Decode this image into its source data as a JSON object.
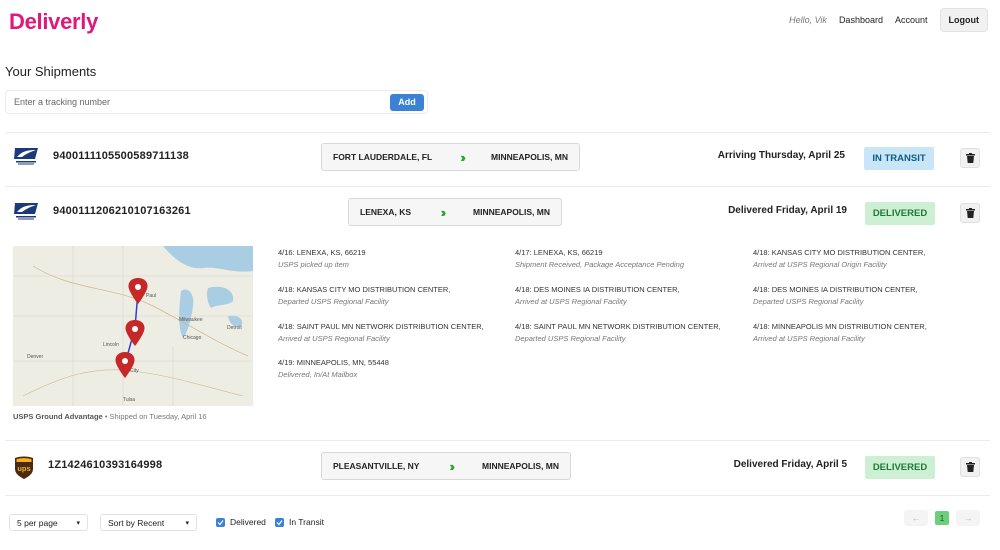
{
  "header": {
    "logo": "Deliverly",
    "greeting": "Hello, Vik",
    "nav_dashboard": "Dashboard",
    "nav_account": "Account",
    "logout": "Logout"
  },
  "page": {
    "title": "Your Shipments",
    "tracking_placeholder": "Enter a tracking number",
    "add_label": "Add"
  },
  "shipments": [
    {
      "carrier_icon": "usps-eagle-icon",
      "tracking": "9400111105500589711138",
      "origin": "FORT LAUDERDALE, FL",
      "destination": "MINNEAPOLIS, MN",
      "arrival": "Arriving Thursday, April 25",
      "status": "IN TRANSIT"
    },
    {
      "carrier_icon": "usps-eagle-icon",
      "tracking": "9400111206210107163261",
      "origin": "LENEXA, KS",
      "destination": "MINNEAPOLIS, MN",
      "arrival": "Delivered Friday, April 19",
      "status": "DELIVERED",
      "map_caption_service": "USPS Ground Advantage",
      "map_caption_rest": " • Shipped on Tuesday, April 16",
      "map_labels": [
        "Paul",
        "Milwaukee",
        "Detroit",
        "Chicago",
        "Lincoln",
        "Denver",
        "City",
        "Tulsa"
      ],
      "events": [
        {
          "loc": "4/16: LENEXA, KS, 66219",
          "desc": "USPS picked up item"
        },
        {
          "loc": "4/17: LENEXA, KS, 66219",
          "desc": "Shipment Received, Package Acceptance Pending"
        },
        {
          "loc": "4/18: KANSAS CITY MO DISTRIBUTION CENTER,",
          "desc": "Arrived at USPS Regional Origin Facility"
        },
        {
          "loc": "4/18: KANSAS CITY MO DISTRIBUTION CENTER,",
          "desc": "Departed USPS Regional Facility"
        },
        {
          "loc": "4/18: DES MOINES IA DISTRIBUTION CENTER,",
          "desc": "Arrived at USPS Regional Facility"
        },
        {
          "loc": "4/18: DES MOINES IA DISTRIBUTION CENTER,",
          "desc": "Departed USPS Regional Facility"
        },
        {
          "loc": "4/18: SAINT PAUL MN NETWORK DISTRIBUTION CENTER,",
          "desc": "Arrived at USPS Regional Facility"
        },
        {
          "loc": "4/18: SAINT PAUL MN NETWORK DISTRIBUTION CENTER,",
          "desc": "Departed USPS Regional Facility"
        },
        {
          "loc": "4/18: MINNEAPOLIS MN DISTRIBUTION CENTER,",
          "desc": "Arrived at USPS Regional Facility"
        },
        {
          "loc": "4/19: MINNEAPOLIS, MN, 55448",
          "desc": "Delivered, In/At Mailbox"
        }
      ]
    },
    {
      "carrier_icon": "ups-shield-icon",
      "carrier_text": "ups",
      "tracking": "1Z1424610393164998",
      "origin": "PLEASANTVILLE, NY",
      "destination": "MINNEAPOLIS, MN",
      "arrival": "Delivered Friday, April 5",
      "status": "DELIVERED"
    }
  ],
  "footer": {
    "per_page": "5 per page",
    "sort": "Sort by Recent",
    "filter_delivered": "Delivered",
    "filter_transit": "In Transit",
    "prev": "←",
    "page": "1",
    "next": "→"
  },
  "colors": {
    "brand": "#e0187b",
    "accent": "#3b82d6",
    "transit_bg": "#c9e6f8",
    "delivered_bg": "#cdefd4",
    "chevron": "#2ca62f",
    "map_pin": "#c62828",
    "route_line": "#2b3fd6"
  }
}
